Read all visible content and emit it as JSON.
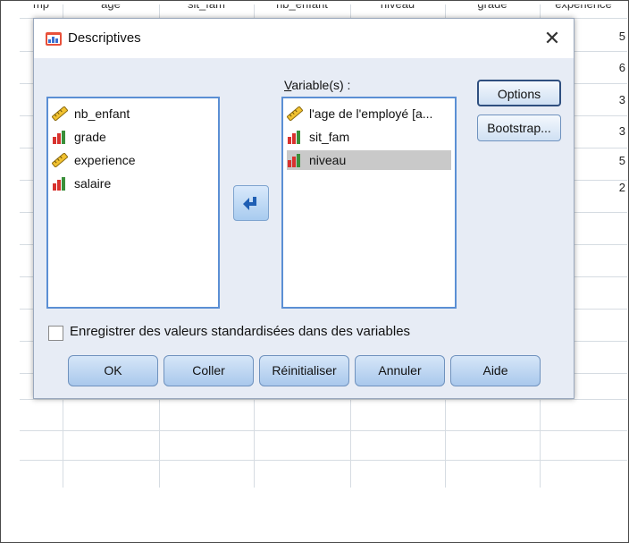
{
  "spreadsheet": {
    "columns": [
      "mp",
      "age",
      "sit_fam",
      "nb_enfant",
      "niveau",
      "grade",
      "experience"
    ],
    "right_digits": [
      "5",
      "6",
      "3",
      "3",
      "5",
      "2"
    ]
  },
  "dialog": {
    "title": "Descriptives",
    "title_icon": "spss-descriptives-icon",
    "close_label": "✕",
    "source_list": [
      {
        "label": "nb_enfant",
        "icon": "ruler-icon"
      },
      {
        "label": "grade",
        "icon": "bar-chart-icon"
      },
      {
        "label": "experience",
        "icon": "ruler-icon"
      },
      {
        "label": "salaire",
        "icon": "bar-chart-icon"
      }
    ],
    "variables_label": "Variable(s) :",
    "variables_list": [
      {
        "label": "l'age de l'employé [a...",
        "icon": "ruler-icon"
      },
      {
        "label": "sit_fam",
        "icon": "bar-chart-icon"
      },
      {
        "label": "niveau",
        "icon": "bar-chart-icon",
        "selected": true
      }
    ],
    "move_button_icon": "arrow-left-icon",
    "options_label": "Options",
    "bootstrap_label": "Bootstrap...",
    "checkbox_label": "Enregistrer des valeurs standardisées dans des variables",
    "checkbox_checked": false,
    "buttons": {
      "ok": "OK",
      "paste": "Coller",
      "reset": "Réinitialiser",
      "cancel": "Annuler",
      "help": "Aide"
    },
    "colors": {
      "accent_border": "#5b8fd4",
      "dialog_bg": "#e7ecf5",
      "selection": "#c9c9c9"
    }
  }
}
